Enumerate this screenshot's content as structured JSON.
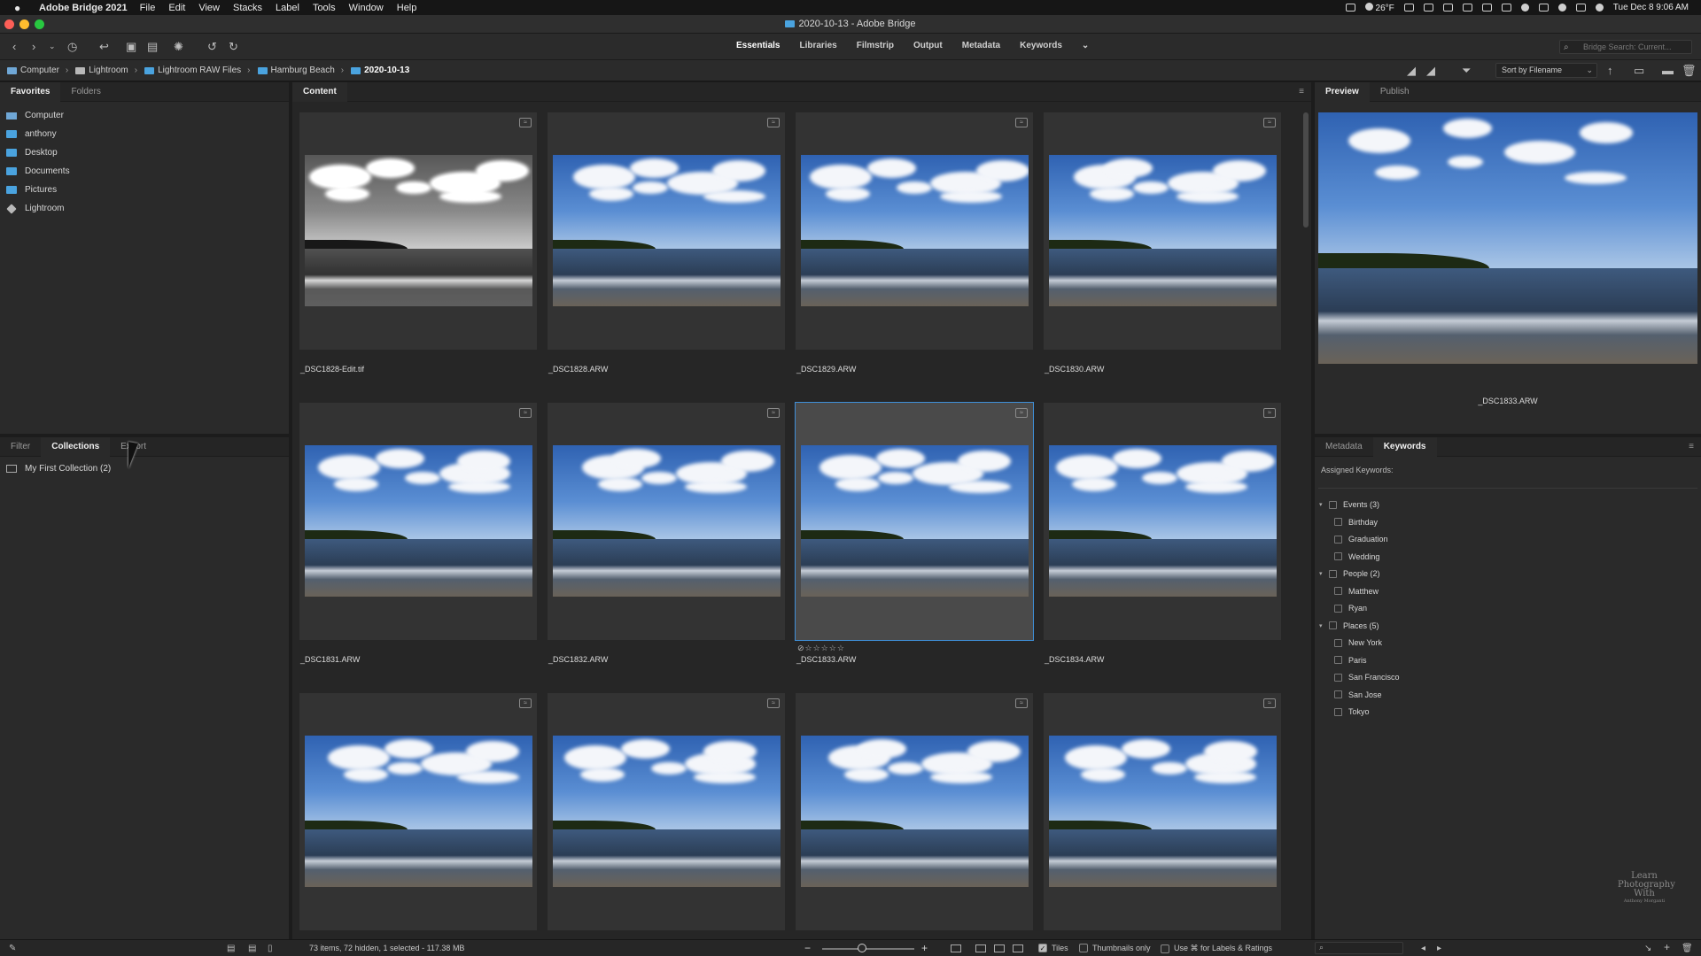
{
  "menubar": {
    "app_name": "Adobe Bridge 2021",
    "items": [
      "File",
      "Edit",
      "View",
      "Stacks",
      "Label",
      "Tools",
      "Window",
      "Help"
    ],
    "weather": "26°F",
    "clock": "Tue Dec 8  9:06 AM"
  },
  "window": {
    "title": "2020-10-13 - Adobe Bridge"
  },
  "workspaces": [
    "Essentials",
    "Libraries",
    "Filmstrip",
    "Output",
    "Metadata",
    "Keywords"
  ],
  "search": {
    "placeholder": "Bridge Search: Current..."
  },
  "path": [
    "Computer",
    "Lightroom",
    "Lightroom RAW Files",
    "Hamburg Beach",
    "2020-10-13"
  ],
  "sort": {
    "label": "Sort by Filename"
  },
  "favorites_panel": {
    "tabs": [
      "Favorites",
      "Folders"
    ],
    "items": [
      "Computer",
      "anthony",
      "Desktop",
      "Documents",
      "Pictures",
      "Lightroom"
    ]
  },
  "collections_panel": {
    "tabs": [
      "Filter",
      "Collections",
      "Export"
    ],
    "items": [
      {
        "name": "My First Collection",
        "count": "(2)"
      }
    ]
  },
  "content_panel": {
    "tab": "Content",
    "thumbnails": [
      {
        "name": "_DSC1828-Edit.tif"
      },
      {
        "name": "_DSC1828.ARW"
      },
      {
        "name": "_DSC1829.ARW"
      },
      {
        "name": "_DSC1830.ARW"
      },
      {
        "name": "_DSC1831.ARW"
      },
      {
        "name": "_DSC1832.ARW"
      },
      {
        "name": "_DSC1833.ARW",
        "selected": true,
        "rating": "⊘☆☆☆☆☆"
      },
      {
        "name": "_DSC1834.ARW"
      },
      {
        "name": ""
      },
      {
        "name": ""
      },
      {
        "name": ""
      },
      {
        "name": ""
      }
    ]
  },
  "preview_panel": {
    "tabs": [
      "Preview",
      "Publish"
    ],
    "caption": "_DSC1833.ARW"
  },
  "keywords_panel": {
    "tabs": [
      "Metadata",
      "Keywords"
    ],
    "assigned_label": "Assigned Keywords:",
    "groups": [
      {
        "name": "Events",
        "count": "(3)",
        "children": [
          "Birthday",
          "Graduation",
          "Wedding"
        ]
      },
      {
        "name": "People",
        "count": "(2)",
        "children": [
          "Matthew",
          "Ryan"
        ]
      },
      {
        "name": "Places",
        "count": "(5)",
        "children": [
          "New York",
          "Paris",
          "San Francisco",
          "San Jose",
          "Tokyo"
        ]
      }
    ]
  },
  "statusbar": {
    "status": "73 items, 72 hidden, 1 selected - 117.38 MB",
    "tiles_label": "Tiles",
    "thumbnails_only_label": "Thumbnails only",
    "use_cmd_label": "Use ⌘ for Labels & Ratings"
  },
  "watermark": {
    "line1": "Learn",
    "line2": "Photography",
    "line3": "With",
    "line4": "Anthony Morganti"
  },
  "colors": {
    "accent": "#3f8fd8",
    "folder": "#4aa3df",
    "panel": "#2a2a2a"
  }
}
